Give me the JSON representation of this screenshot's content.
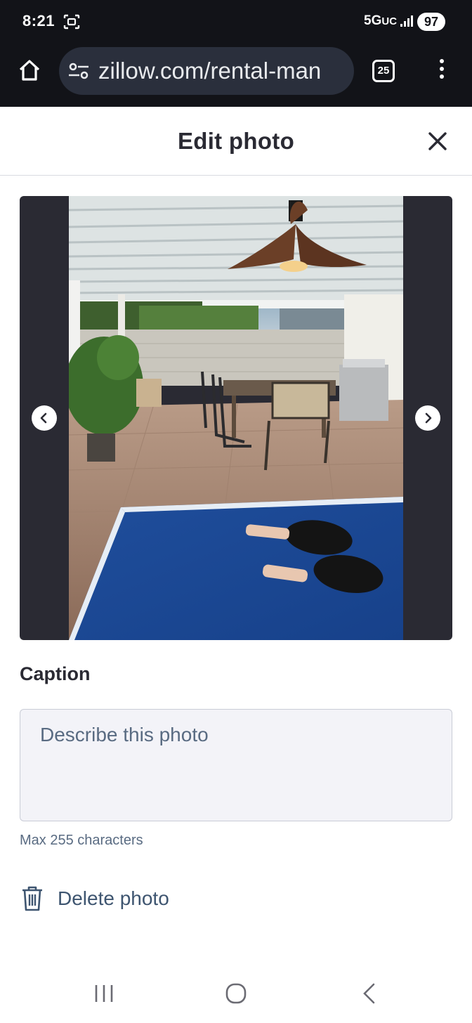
{
  "status_bar": {
    "time": "8:21",
    "network": "5G",
    "network_suffix": "UC",
    "battery": "97"
  },
  "browser": {
    "url": "zillow.com/rental-man",
    "tab_count": "25"
  },
  "modal": {
    "title": "Edit photo"
  },
  "caption": {
    "label": "Caption",
    "placeholder": "Describe this photo",
    "value": "",
    "hint": "Max 255 characters"
  },
  "delete": {
    "label": "Delete photo"
  },
  "icons": {
    "home": "home-icon",
    "site_settings": "tune-icon",
    "tabs": "tabs-count-icon",
    "menu": "more-vert-icon",
    "close": "close-icon",
    "prev": "chevron-left-icon",
    "next": "chevron-right-icon",
    "delete": "trash-icon"
  },
  "colors": {
    "chrome_bg": "#121318",
    "text_primary": "#2a2a33",
    "text_secondary": "#596b82",
    "input_bg": "#f3f3f8",
    "photo_frame_bg": "#2a2a33"
  }
}
